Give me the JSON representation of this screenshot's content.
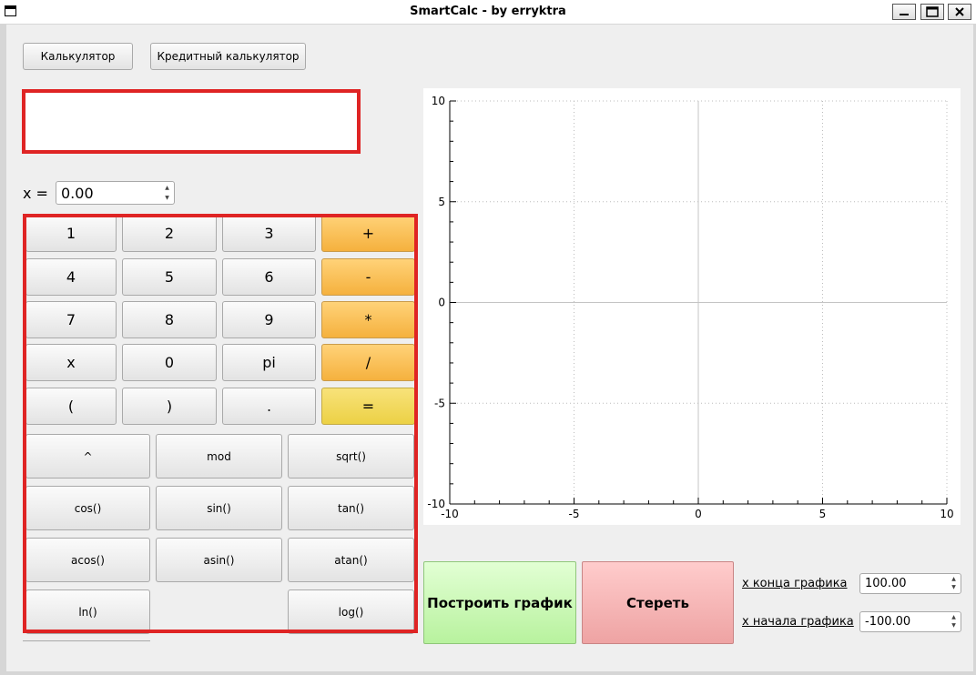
{
  "window": {
    "title": "SmartCalc - by erryktra"
  },
  "tabs": {
    "calculator": "Калькулятор",
    "credit_calculator": "Кредитный калькулятор"
  },
  "expression": {
    "value": ""
  },
  "x_input": {
    "label": "x =",
    "value": "0.00"
  },
  "keypad": {
    "rows": [
      [
        "1",
        "2",
        "3",
        "+"
      ],
      [
        "4",
        "5",
        "6",
        "-"
      ],
      [
        "7",
        "8",
        "9",
        "*"
      ],
      [
        "x",
        "0",
        "pi",
        "/"
      ],
      [
        "(",
        ")",
        ".",
        "="
      ]
    ],
    "functions": [
      [
        "^",
        "mod",
        "sqrt()"
      ],
      [
        "cos()",
        "sin()",
        "tan()"
      ],
      [
        "acos()",
        "asin()",
        "atan()"
      ],
      [
        "ln()",
        "",
        "log()"
      ]
    ]
  },
  "colors": {
    "operator": "#f5b13e",
    "equals": "#ecd145",
    "build": "#b8f29e",
    "clear": "#eea3a3",
    "highlight": "#df2424"
  },
  "chart_data": {
    "type": "line",
    "series": [],
    "xlim": [
      -10,
      10
    ],
    "ylim": [
      -10,
      10
    ],
    "x_ticks": [
      "-10",
      "-5",
      "0",
      "5",
      "10"
    ],
    "y_ticks": [
      "10",
      "5",
      "0",
      "-5",
      "-10"
    ],
    "grid": true
  },
  "actions": {
    "build": "Построить график",
    "clear": "Стереть"
  },
  "range": {
    "x_end_label": "x конца графика",
    "x_end_value": "100.00",
    "x_start_label": "x начала графика",
    "x_start_value": "-100.00"
  }
}
